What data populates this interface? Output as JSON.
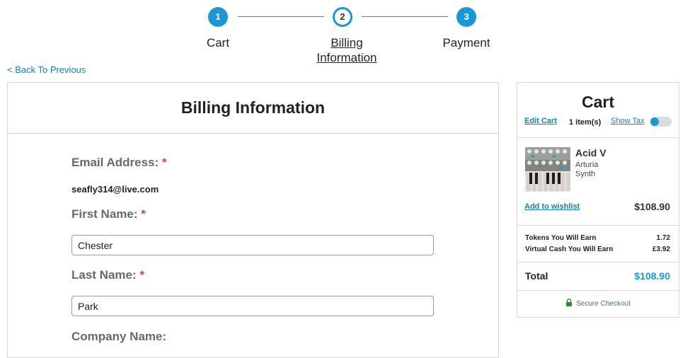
{
  "stepper": {
    "steps": [
      {
        "number": "1",
        "label": "Cart",
        "state": "done"
      },
      {
        "number": "2",
        "label_line1": "Billing",
        "label_line2": "Information",
        "state": "active"
      },
      {
        "number": "3",
        "label": "Payment",
        "state": "done"
      }
    ],
    "accent_color": "#1a98d5"
  },
  "nav": {
    "back_label": "< Back To Previous"
  },
  "billing": {
    "title": "Billing Information",
    "email_label": "Email Address:",
    "email_value": "seafly314@live.com",
    "first_name_label": "First Name:",
    "first_name_value": "Chester",
    "last_name_label": "Last Name:",
    "last_name_value": "Park",
    "company_label": "Company Name:",
    "required_marker": "*"
  },
  "cart": {
    "title": "Cart",
    "edit_label": "Edit Cart",
    "item_count": "1 item(s)",
    "show_tax_label": "Show Tax",
    "items": [
      {
        "name": "Acid V",
        "brand": "Arturia",
        "category": "Synth",
        "wishlist_label": "Add to wishlist",
        "price": "$108.90",
        "thumbnail_icon": "synth-thumbnail"
      }
    ],
    "tokens_label": "Tokens You Will Earn",
    "tokens_value": "1.72",
    "cash_label": "Virtual Cash You Will Earn",
    "cash_value": "£3.92",
    "total_label": "Total",
    "total_value": "$108.90",
    "secure_label": "Secure Checkout",
    "secure_icon": "lock-icon",
    "secure_color": "#2e8b2e",
    "total_color": "#1a98d5"
  }
}
